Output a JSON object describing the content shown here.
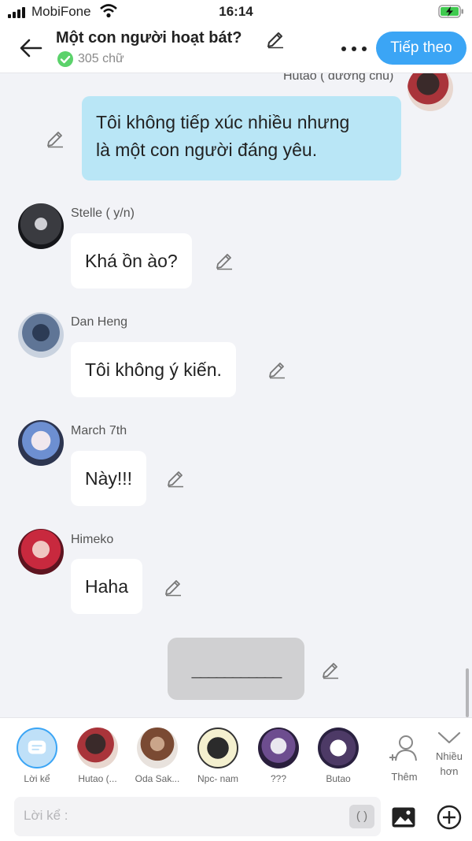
{
  "status": {
    "carrier": "MobiFone",
    "time": "16:14"
  },
  "header": {
    "title": "Một con người hoạt bát?",
    "word_count": "305 chữ",
    "next_label": "Tiếp theo"
  },
  "messages": [
    {
      "speaker": "Hutao ( dương chủ)",
      "text_line1": "Tôi không tiếp xúc nhiều nhưng",
      "text_line2": "là một con người đáng yêu."
    },
    {
      "speaker": "Stelle ( y/n)",
      "text": "Khá ồn ào?"
    },
    {
      "speaker": "Dan Heng",
      "text": "Tôi không ý kiến."
    },
    {
      "speaker": "March 7th",
      "text": "Này!!!"
    },
    {
      "speaker": "Himeko",
      "text": "Haha"
    }
  ],
  "divider_text": "___________",
  "characters": [
    {
      "label": "Lời kể"
    },
    {
      "label": "Hutao (..."
    },
    {
      "label": "Oda Sak..."
    },
    {
      "label": "Npc- nam"
    },
    {
      "label": "???"
    },
    {
      "label": "Butao"
    }
  ],
  "add_label": "Thêm",
  "more_label_1": "Nhiều",
  "more_label_2": "hơn",
  "input": {
    "placeholder": "Lời kể :",
    "paren": "( )"
  },
  "colors": {
    "accent": "#3ba5f5",
    "self_bubble": "#b9e6f6",
    "check": "#5bd26b"
  }
}
